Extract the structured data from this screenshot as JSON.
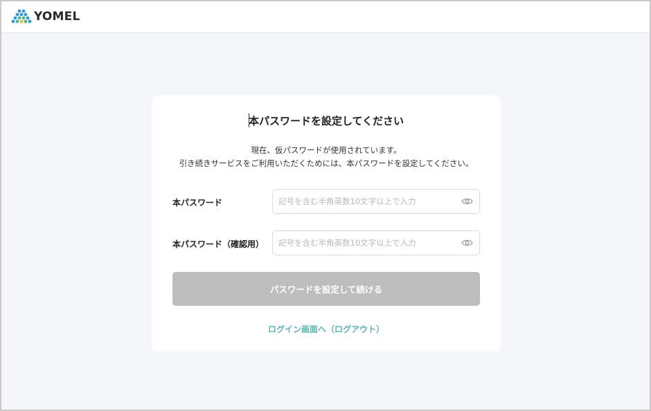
{
  "header": {
    "logo_text": "YOMEL",
    "logo_icon": "yomel-logo-icon"
  },
  "form": {
    "title": "本パスワードを設定してください",
    "desc_line1": "現在、仮パスワードが使用されています。",
    "desc_line2": "引き続きサービスをご利用いただくためには、本パスワードを設定してください。",
    "password": {
      "label": "本パスワード",
      "value": "",
      "placeholder": "記号を含む半角英数10文字以上で入力",
      "icon": "eye-icon"
    },
    "password_confirm": {
      "label": "本パスワード（確認用）",
      "value": "",
      "placeholder": "記号を含む半角英数10文字以上で入力",
      "icon": "eye-icon"
    },
    "submit_label": "パスワードを設定して続ける",
    "logout_link": "ログイン画面へ（ログアウト）"
  },
  "colors": {
    "accent": "#5bb3b0",
    "button_disabled": "#bdbdbd",
    "background": "#f5f6fa"
  }
}
